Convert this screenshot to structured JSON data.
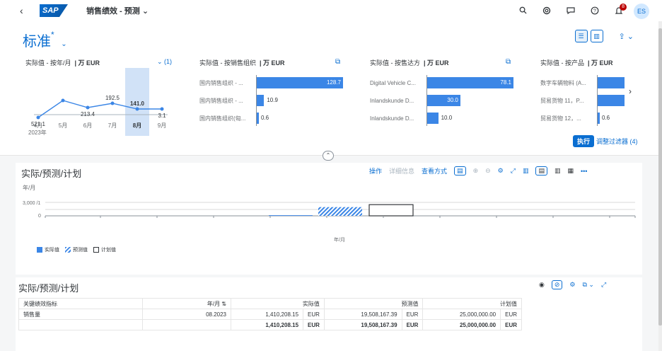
{
  "shell": {
    "back_icon": "‹",
    "logo_text": "SAP",
    "app_title": "销售绩效 - 预测",
    "app_title_chevron": "⌄",
    "icons": [
      "search-icon",
      "copilot-icon",
      "chat-icon",
      "help-icon",
      "bell-icon"
    ],
    "notification_count": "8",
    "avatar": "ES"
  },
  "header": {
    "variant": "标准",
    "variant_mark": "*",
    "kpis": [
      {
        "title": "实际值 - 按年/月",
        "unit": "| 万 EUR",
        "link": "⌄ (1)",
        "months": [
          "4月",
          "5月",
          "6月",
          "7月",
          "8月",
          "9月"
        ],
        "values": [
          "521.1",
          "",
          "213.4",
          "192.5",
          "141.0",
          "3.1"
        ],
        "series": [
          521.1,
          680,
          560,
          660,
          500,
          490
        ],
        "year": "2023年",
        "selected": 4
      },
      {
        "title": "实际值 - 按销售组织",
        "unit": "| 万 EUR",
        "rows": [
          {
            "label": "国内销售组织 - ...",
            "value": 128.7,
            "text": "128.7"
          },
          {
            "label": "国内销售组织 - ...",
            "value": 10.9,
            "text": "10.9"
          },
          {
            "label": "国内销售组织(匈...",
            "value": 0.6,
            "text": "0.6"
          }
        ],
        "max": 128.7
      },
      {
        "title": "实际值 - 按售达方",
        "unit": "| 万 EUR",
        "rows": [
          {
            "label": "Digital Vehicle C...",
            "value": 78.1,
            "text": "78.1"
          },
          {
            "label": "Inlandskunde D...",
            "value": 30.0,
            "text": "30.0"
          },
          {
            "label": "Inlandskunde D...",
            "value": 10.0,
            "text": "10.0"
          }
        ],
        "max": 78.1
      },
      {
        "title": "实际值 - 按产品",
        "unit": "| 万 EUR",
        "rows": [
          {
            "label": "数字车辆物料 (A...",
            "value": 100,
            "text": ""
          },
          {
            "label": "贸易货物 11，P...",
            "value": 100,
            "text": ""
          },
          {
            "label": "贸易货物 12，...",
            "value": 0.6,
            "text": "0.6"
          }
        ],
        "max": 100
      }
    ],
    "execute": "执行",
    "adjust_filter": "调整过滤器 (4)"
  },
  "chart_card": {
    "title": "实际/预测/计划",
    "toolbar": {
      "actions": "操作",
      "details": "详细信息",
      "view_by": "查看方式"
    },
    "y_unit": "年/月",
    "y_tick_top": "3,000 /1",
    "y_tick_zero": "0",
    "x_label": "年/月",
    "legend": [
      "实际值",
      "预测值",
      "计划值"
    ]
  },
  "chart_data": {
    "type": "bar",
    "categories": [
      "",
      "",
      ""
    ],
    "series": [
      {
        "name": "实际值",
        "values": [
          141
        ]
      },
      {
        "name": "预测值",
        "values": [
          1951
        ]
      },
      {
        "name": "计划值",
        "values": [
          2500
        ]
      }
    ],
    "ylabel": "年/月",
    "xlabel": "年/月"
  },
  "table_card": {
    "title": "实际/预测/计划",
    "columns": [
      "关键绩效指标",
      "年/月 ⇅",
      "实际值",
      "预测值",
      "计划值"
    ],
    "rows": [
      {
        "kpi": "销售量",
        "month": "08.2023",
        "actual": "1,410,208.15",
        "actual_cur": "EUR",
        "forecast": "19,508,167.39",
        "forecast_cur": "EUR",
        "plan": "25,000,000.00",
        "plan_cur": "EUR"
      },
      {
        "kpi": "",
        "month": "",
        "actual": "1,410,208.15",
        "actual_cur": "EUR",
        "forecast": "19,508,167.39",
        "forecast_cur": "EUR",
        "plan": "25,000,000.00",
        "plan_cur": "EUR"
      }
    ]
  },
  "colors": {
    "accent": "#0a6ed1",
    "bar": "#3b86e6"
  }
}
